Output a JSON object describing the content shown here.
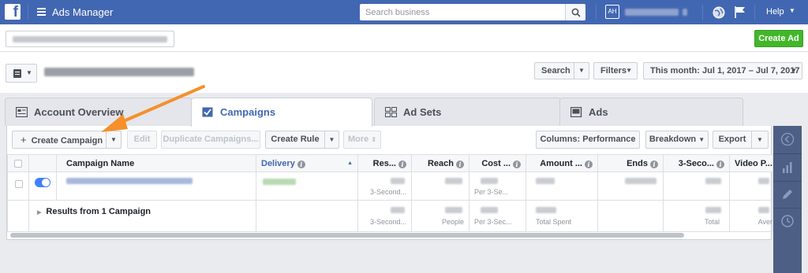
{
  "topbar": {
    "logo": "f",
    "title": "Ads Manager",
    "search_placeholder": "Search business",
    "avatar_initials": "AH",
    "help_label": "Help"
  },
  "account_bar": {
    "create_ad_label": "Create Ad"
  },
  "header": {
    "search_label": "Search",
    "filters_label": "Filters",
    "date_range_label": "This month: Jul 1, 2017 – Jul 7, 2017"
  },
  "tabs": [
    {
      "label": "Account Overview",
      "icon": "dashboard-icon"
    },
    {
      "label": "Campaigns",
      "icon": "checkbox-icon"
    },
    {
      "label": "Ad Sets",
      "icon": "grid-icon"
    },
    {
      "label": "Ads",
      "icon": "ad-icon"
    }
  ],
  "toolbar": {
    "create_campaign_label": "Create Campaign",
    "edit_label": "Edit",
    "duplicate_label": "Duplicate Campaigns...",
    "create_rule_label": "Create Rule",
    "more_label": "More",
    "columns_label": "Columns: Performance",
    "breakdown_label": "Breakdown",
    "export_label": "Export"
  },
  "table": {
    "headers": [
      "Campaign Name",
      "Delivery",
      "Res...",
      "Reach",
      "Cost ...",
      "Amount ...",
      "Ends",
      "3-Seco...",
      "Video P..."
    ],
    "row_subtexts": {
      "results": "3-Second...",
      "cost": "Per 3-Se..."
    },
    "summary": {
      "label": "Results from 1 Campaign",
      "results_sub": "3-Second...",
      "reach_sub": "People",
      "cost_sub": "Per 3-Sec...",
      "amount_sub": "Total Spent",
      "three_sec_sub": "Total",
      "video_sub": "Aver"
    }
  },
  "colors": {
    "brand_blue": "#4267b2",
    "create_green": "#42b72a",
    "toggle_blue": "#4080ff",
    "annotation_orange": "#f5902a"
  }
}
